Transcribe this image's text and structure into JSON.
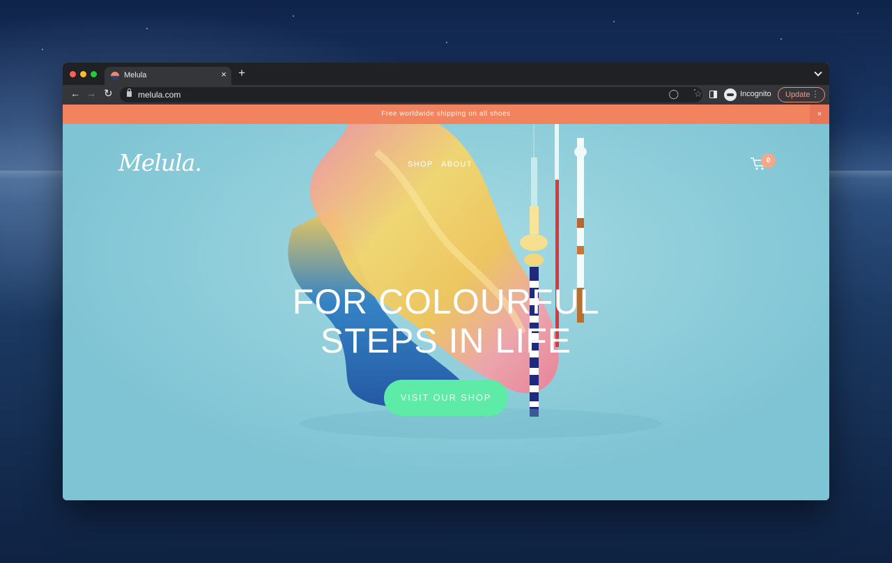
{
  "browser": {
    "tab_title": "Melula",
    "tab_close": "×",
    "new_tab": "+",
    "url": "melula.com",
    "incognito_label": "Incognito",
    "update_label": "Update"
  },
  "site": {
    "announcement": "Free worldwide shipping on all shoes",
    "announcement_close": "×",
    "logo": "Melula.",
    "nav": {
      "shop": "SHOP",
      "about": "ABOUT"
    },
    "cart_count": "0",
    "headline_line1": "FOR COLOURFUL",
    "headline_line2": "STEPS IN LIFE",
    "cta_label": "VISIT OUR SHOP"
  },
  "colors": {
    "announcement_bar": "#f1845f",
    "hero_background": "#8fcfdb",
    "cta_button": "#5eeaa7",
    "cart_badge": "#f3a88b",
    "update_accent": "#ee8d79"
  },
  "icons": {
    "back": "arrow-left-icon",
    "forward": "arrow-right-icon",
    "reload": "reload-icon",
    "lock": "lock-icon",
    "tracking": "eye-off-icon",
    "bookmark": "star-icon",
    "side_panel": "side-panel-icon",
    "incognito": "incognito-icon",
    "menu": "kebab-icon",
    "cart": "cart-icon"
  }
}
